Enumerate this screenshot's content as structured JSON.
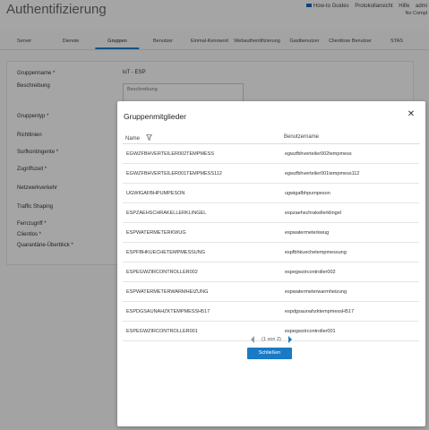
{
  "app": {
    "title": "Authentifizierung",
    "header_links": [
      "How-to Guides",
      "Protokollansicht",
      "Hilfe",
      "admi"
    ],
    "header_sub": "No Compl"
  },
  "tabs": [
    {
      "label": "Server",
      "active": false
    },
    {
      "label": "Dienste",
      "active": false
    },
    {
      "label": "Gruppen",
      "active": true
    },
    {
      "label": "Benutzer",
      "active": false
    },
    {
      "label": "Einmal-Kennwort",
      "active": false
    },
    {
      "label": "Webauthentifizierung",
      "active": false
    },
    {
      "label": "Gastbenutzer",
      "active": false
    },
    {
      "label": "Clientlose Benutzer",
      "active": false
    },
    {
      "label": "STAS",
      "active": false
    }
  ],
  "form": {
    "labels": [
      "Gruppenname *",
      "Beschreibung",
      "Gruppentyp *",
      "Richtlinien",
      "Surfkontingente *",
      "Zugriffszeit *",
      "Netzwerkverkehr",
      "Traffic Shaping",
      "Fernzugriff *",
      "Clientlos *",
      "Quarantäne-Überblick *"
    ],
    "group_name": "loT - ESP",
    "description_placeholder": "Beschreibung"
  },
  "modal": {
    "title": "Gruppenmitglieder",
    "columns": {
      "name": "Name",
      "username": "Benutzername"
    },
    "rows": [
      {
        "name": "EGWZFBHVERTEILER002TEMPMESS",
        "username": "egwzfbhverteiler002tempmess"
      },
      {
        "name": "EGWZFBHVERTEILER001TEMPMESS112",
        "username": "egwzfbhverteiler001tempmess112"
      },
      {
        "name": "UGWIGAFBHPUMPESON",
        "username": "ugwigafbhpumpeson"
      },
      {
        "name": "ESPZAEHSCHRAKELLERKLINGEL",
        "username": "espzaehschrakellerklingel"
      },
      {
        "name": "ESPWATERMETERKWUG",
        "username": "espwatermeterkwug"
      },
      {
        "name": "ESPFBHKUECHETEMPMESSUNG",
        "username": "espfbhkuechetempmessung"
      },
      {
        "name": "ESPEGWZIRCONTROLLER002",
        "username": "espegwzircontroller002"
      },
      {
        "name": "ESPWATERMETERWARMHEIZUNG",
        "username": "espwatermeterwarmheizung"
      },
      {
        "name": "ESPDGSAUNAHZKTEMPMESSH517",
        "username": "espdgsaunahzktempmessH517"
      },
      {
        "name": "ESPEGWZIRCONTROLLER001",
        "username": "espegwzircontroller001"
      }
    ],
    "pagination": "(1 von 2)",
    "close_button": "Schließen"
  },
  "colors": {
    "accent": "#1a7bc4"
  }
}
